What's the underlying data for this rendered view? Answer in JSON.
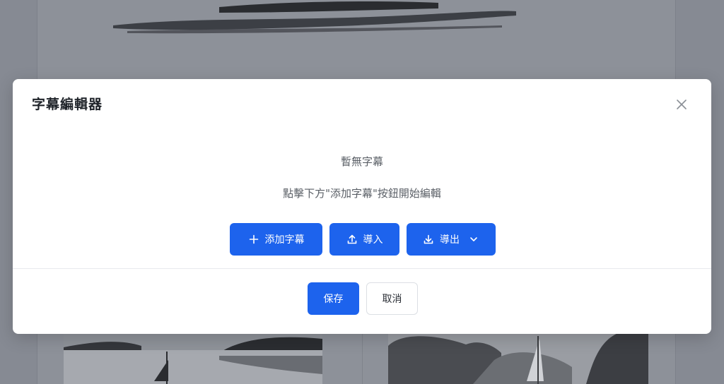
{
  "dialog": {
    "title": "字幕編輯器",
    "close_icon": "close-icon"
  },
  "empty_state": {
    "title": "暫無字幕",
    "hint": "點擊下方\"添加字幕\"按鈕開始編輯"
  },
  "actions": {
    "add_label": "添加字幕",
    "add_icon": "plus-icon",
    "import_label": "導入",
    "import_icon": "upload-icon",
    "export_label": "導出",
    "export_icon": "download-icon",
    "export_dropdown_icon": "chevron-down-icon"
  },
  "footer": {
    "save_label": "保存",
    "cancel_label": "取消"
  },
  "colors": {
    "primary": "#1d63ed",
    "backdrop": "#868a93",
    "text_muted": "#5a5f66"
  }
}
